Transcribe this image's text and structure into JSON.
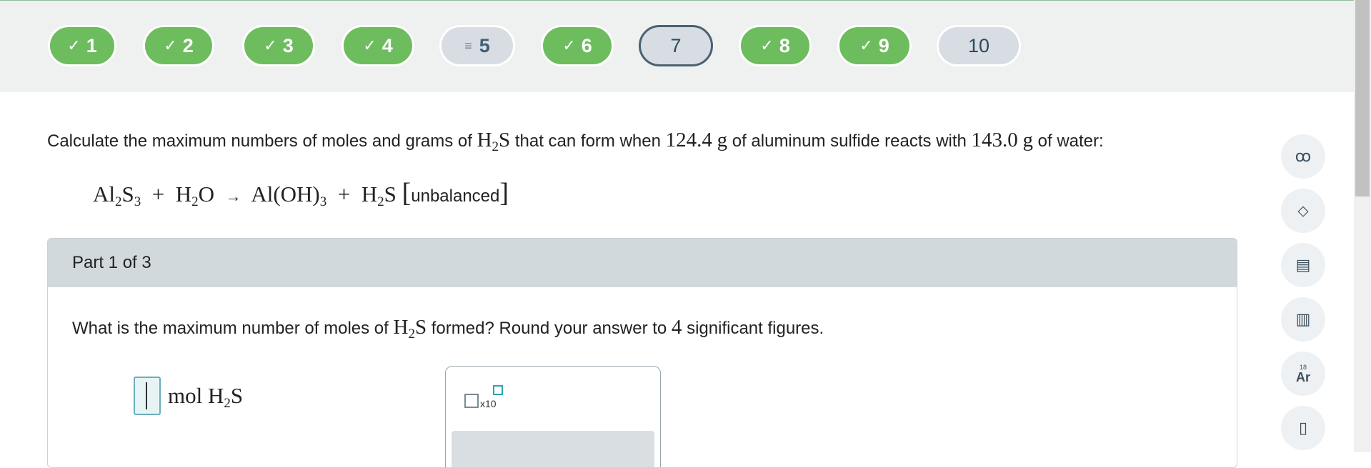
{
  "nav": {
    "questions": [
      {
        "label": "1",
        "status": "done"
      },
      {
        "label": "2",
        "status": "done"
      },
      {
        "label": "3",
        "status": "done"
      },
      {
        "label": "4",
        "status": "done"
      },
      {
        "label": "5",
        "status": "partial"
      },
      {
        "label": "6",
        "status": "done"
      },
      {
        "label": "7",
        "status": "current"
      },
      {
        "label": "8",
        "status": "done"
      },
      {
        "label": "9",
        "status": "done"
      },
      {
        "label": "10",
        "status": "todo"
      }
    ],
    "check_glyph": "✓",
    "partial_glyph": "≡"
  },
  "question": {
    "intro_a": "Calculate the maximum numbers of moles and grams of ",
    "species_main": "H",
    "species_sub": "2",
    "species_tail": "S",
    "intro_b": " that can form when ",
    "mass1": "124.4",
    "unit1": "g",
    "intro_c": " of aluminum sulfide reacts with ",
    "mass2": "143.0",
    "unit2": "g",
    "intro_d": " of water:"
  },
  "equation": {
    "r1_a": "Al",
    "r1_s1": "2",
    "r1_b": "S",
    "r1_s2": "3",
    "plus1": "+",
    "r2_a": "H",
    "r2_s1": "2",
    "r2_b": "O",
    "arrow": "→",
    "p1_a": "Al(OH)",
    "p1_s1": "3",
    "plus2": "+",
    "p2_a": "H",
    "p2_s1": "2",
    "p2_b": "S",
    "lbr": "[",
    "tag": "unbalanced",
    "rbr": "]"
  },
  "part": {
    "header": "Part 1 of 3",
    "prompt_a": "What is the maximum number of moles of ",
    "prompt_sp_a": "H",
    "prompt_sp_sub": "2",
    "prompt_sp_b": "S",
    "prompt_b": " formed? Round your answer to ",
    "sig_figs": "4",
    "prompt_c": " significant figures.",
    "answer_value": "",
    "unit_a": "mol H",
    "unit_sub": "2",
    "unit_b": "S",
    "sci_label": "x10"
  },
  "tools": [
    {
      "icon": "glasses-icon",
      "glyph": "ꝏ"
    },
    {
      "icon": "directions-icon",
      "glyph": "⬦"
    },
    {
      "icon": "notes-icon",
      "glyph": "▤"
    },
    {
      "icon": "bar-chart-icon",
      "glyph": "▥"
    },
    {
      "icon": "periodic-table-icon",
      "glyph": "Ar",
      "sup": "18"
    },
    {
      "icon": "book-icon",
      "glyph": "▯"
    }
  ]
}
